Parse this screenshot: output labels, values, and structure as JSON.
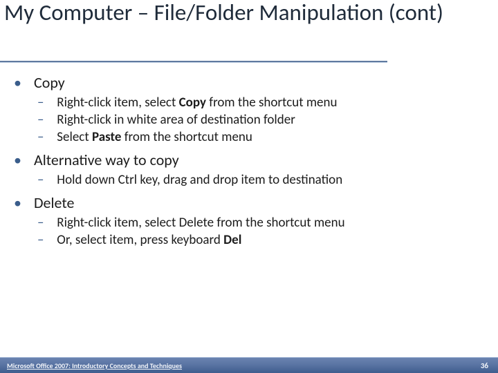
{
  "title": "My Computer – File/Folder Manipulation (cont)",
  "bullets": {
    "b1": {
      "label": "Copy",
      "subs": {
        "s1a": "Right-click item, select ",
        "s1b": "Copy",
        "s1c": " from the shortcut menu",
        "s2": "Right-click in white area of destination folder",
        "s3a": "Select ",
        "s3b": "Paste",
        "s3c": " from the shortcut menu"
      }
    },
    "b2": {
      "label": "Alternative way to copy",
      "subs": {
        "s1": "Hold down Ctrl key, drag and drop item to destination"
      }
    },
    "b3": {
      "label": "Delete",
      "subs": {
        "s1": "Right-click item, select Delete from the shortcut menu",
        "s2a": "Or, select item, press keyboard ",
        "s2b": "Del"
      }
    }
  },
  "footer": {
    "text": "Microsoft Office 2007: Introductory Concepts and Techniques",
    "page": "36"
  }
}
